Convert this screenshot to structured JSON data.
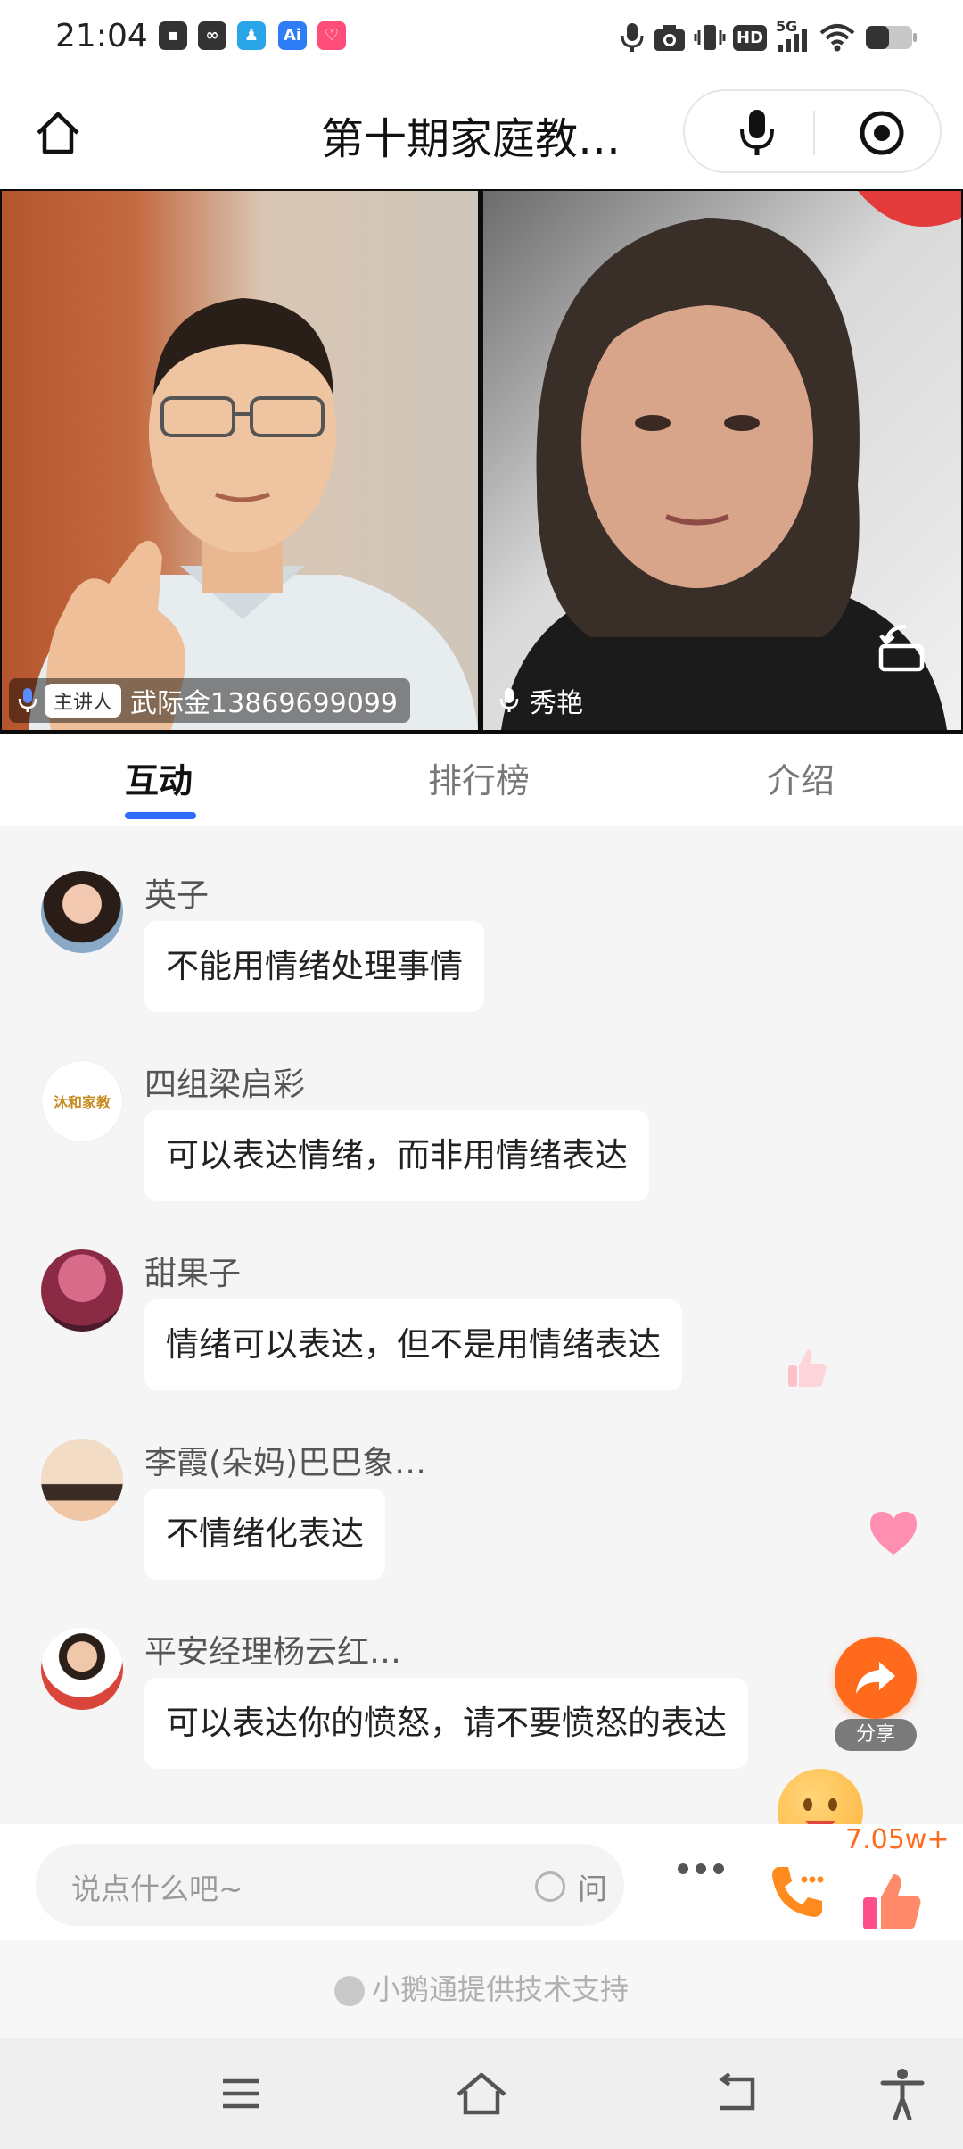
{
  "status_bar": {
    "time": "21:04",
    "app_icons": [
      "message-app-icon",
      "link-app-icon",
      "qq-icon",
      "ai-app-icon",
      "lala-app-icon"
    ],
    "right_icons": [
      "mic-in-use-icon",
      "camera-in-use-icon",
      "vibrate-icon",
      "hd-icon",
      "5g-signal-icon",
      "wifi-icon",
      "battery-icon"
    ],
    "hd_label": "HD",
    "network_label": "5G"
  },
  "header": {
    "title": "第十期家庭教…"
  },
  "videos": {
    "host": {
      "badge": "主讲人",
      "name": "武际金13869699099"
    },
    "guest": {
      "name": "秀艳"
    }
  },
  "tabs": [
    {
      "label": "互动",
      "active": true
    },
    {
      "label": "排行榜",
      "active": false
    },
    {
      "label": "介绍",
      "active": false
    }
  ],
  "messages": [
    {
      "name": "英子",
      "text": "不能用情绪处理事情"
    },
    {
      "name": "四组梁启彩",
      "text": "可以表达情绪，而非用情绪表达",
      "avatar_text": "沐和家教"
    },
    {
      "name": "甜果子",
      "text": "情绪可以表达，但不是用情绪表达"
    },
    {
      "name": "李霞(朵妈)巴巴象…",
      "text": "不情绪化表达"
    },
    {
      "name": "平安经理杨云红…",
      "text": "可以表达你的愤怒，请不要愤怒的表达"
    }
  ],
  "share": {
    "label": "分享"
  },
  "input_bar": {
    "placeholder": "说点什么吧~",
    "ask_label": "问",
    "like_count": "7.05w+"
  },
  "footer": {
    "powered_by": "小鹅通提供技术支持"
  },
  "colors": {
    "accent": "#2f6df6",
    "share": "#ff6a1d",
    "like": "#ff7a6a"
  }
}
